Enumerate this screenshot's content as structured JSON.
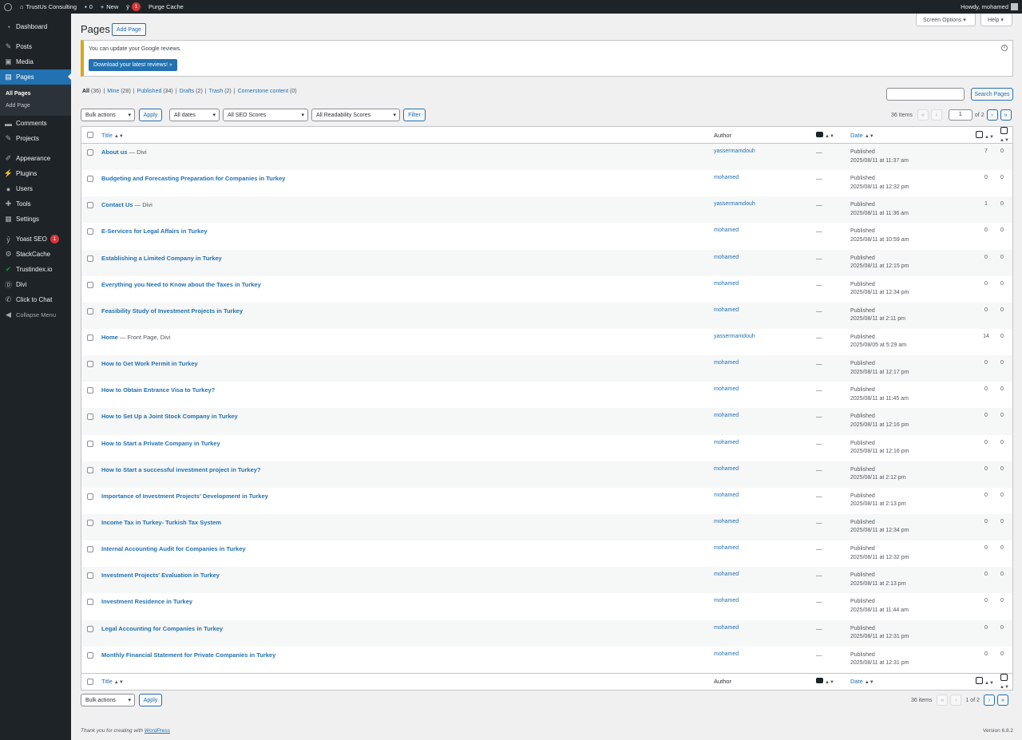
{
  "adminbar": {
    "site_name": "TrustUs Consulting",
    "comments_count": "0",
    "new_label": "New",
    "yoast_badge": "1",
    "purge_label": "Purge Cache",
    "howdy": "Howdy, mohamed"
  },
  "sidebar": {
    "items": [
      {
        "label": "Dashboard",
        "icon": "dashboard-icon"
      },
      {
        "label": "Posts",
        "icon": "pin-icon"
      },
      {
        "label": "Media",
        "icon": "media-icon"
      },
      {
        "label": "Pages",
        "icon": "page-icon"
      },
      {
        "label": "Comments",
        "icon": "comment-icon"
      },
      {
        "label": "Projects",
        "icon": "pin-icon"
      },
      {
        "label": "Appearance",
        "icon": "brush-icon"
      },
      {
        "label": "Plugins",
        "icon": "plug-icon"
      },
      {
        "label": "Users",
        "icon": "user-icon"
      },
      {
        "label": "Tools",
        "icon": "wrench-icon"
      },
      {
        "label": "Settings",
        "icon": "settings-icon"
      },
      {
        "label": "Yoast SEO",
        "icon": "yoast-icon",
        "badge": "1"
      },
      {
        "label": "StackCache",
        "icon": "gear-icon"
      },
      {
        "label": "Trustindex.io",
        "icon": "check-icon"
      },
      {
        "label": "Divi",
        "icon": "divi-icon"
      },
      {
        "label": "Click to Chat",
        "icon": "whatsapp-icon"
      },
      {
        "label": "Collapse Menu",
        "icon": "collapse-icon"
      }
    ],
    "submenu": [
      "All Pages",
      "Add Page"
    ]
  },
  "header": {
    "screen_options": "Screen Options ▾",
    "help": "Help ▾",
    "title": "Pages",
    "add_page": "Add Page"
  },
  "notice": {
    "message": "You can update your Google reviews.",
    "button": "Download your latest reviews! »"
  },
  "filters_links": [
    {
      "label": "All",
      "count": "(36)"
    },
    {
      "label": "Mine",
      "count": "(28)"
    },
    {
      "label": "Published",
      "count": "(34)"
    },
    {
      "label": "Drafts",
      "count": "(2)"
    },
    {
      "label": "Trash",
      "count": "(2)"
    },
    {
      "label": "Cornerstone content",
      "count": "(0)"
    }
  ],
  "search": {
    "button": "Search Pages"
  },
  "toolbar": {
    "bulk_actions": "Bulk actions",
    "apply": "Apply",
    "all_dates": "All dates",
    "seo_scores": "All SEO Scores",
    "readability": "All Readability Scores",
    "filter": "Filter"
  },
  "pagination": {
    "items_top": "36 Items",
    "items_bottom": "36 items",
    "current_page": "1",
    "of_pages": "of 2",
    "bottom_text": "1 of 2",
    "first": "«",
    "prev": "‹",
    "next": "›",
    "last": "»"
  },
  "columns": {
    "title": "Title",
    "author": "Author",
    "date": "Date",
    "sort": "▲▼"
  },
  "rows": [
    {
      "title": "About us",
      "state": " — Divi",
      "author": "yassermamdouh",
      "comments": "—",
      "status": "Published",
      "date": "2025/08/11 at 11:37 am",
      "links_in": "7",
      "links_out": "0"
    },
    {
      "title": "Budgeting and Forecasting Preparation for Companies in Turkey",
      "state": "",
      "author": "mohamed",
      "comments": "—",
      "status": "Published",
      "date": "2025/08/11 at 12:32 pm",
      "links_in": "0",
      "links_out": "0"
    },
    {
      "title": "Contact Us",
      "state": " — Divi",
      "author": "yassermamdouh",
      "comments": "—",
      "status": "Published",
      "date": "2025/08/11 at 11:36 am",
      "links_in": "1",
      "links_out": "0"
    },
    {
      "title": "E-Services for Legal Affairs in Turkey",
      "state": "",
      "author": "mohamed",
      "comments": "—",
      "status": "Published",
      "date": "2025/08/11 at 10:59 am",
      "links_in": "0",
      "links_out": "0"
    },
    {
      "title": "Establishing a Limited Company in Turkey",
      "state": "",
      "author": "mohamed",
      "comments": "—",
      "status": "Published",
      "date": "2025/08/11 at 12:15 pm",
      "links_in": "0",
      "links_out": "0"
    },
    {
      "title": "Everything you Need to Know about the Taxes in Turkey",
      "state": "",
      "author": "mohamed",
      "comments": "—",
      "status": "Published",
      "date": "2025/08/11 at 12:34 pm",
      "links_in": "0",
      "links_out": "0"
    },
    {
      "title": "Feasibility Study of Investment Projects in Turkey",
      "state": "",
      "author": "mohamed",
      "comments": "—",
      "status": "Published",
      "date": "2025/08/11 at 2:11 pm",
      "links_in": "0",
      "links_out": "0"
    },
    {
      "title": "Home",
      "state": " — Front Page, Divi",
      "author": "yassermamdouh",
      "comments": "—",
      "status": "Published",
      "date": "2025/08/05 at 5:29 am",
      "links_in": "14",
      "links_out": "0"
    },
    {
      "title": "How to Get Work Permit in Turkey",
      "state": "",
      "author": "mohamed",
      "comments": "—",
      "status": "Published",
      "date": "2025/08/11 at 12:17 pm",
      "links_in": "0",
      "links_out": "0"
    },
    {
      "title": "How to Obtain Entrance Visa to Turkey?",
      "state": "",
      "author": "mohamed",
      "comments": "—",
      "status": "Published",
      "date": "2025/08/11 at 11:45 am",
      "links_in": "0",
      "links_out": "0"
    },
    {
      "title": "How to Set Up a Joint Stock Company in Turkey",
      "state": "",
      "author": "mohamed",
      "comments": "—",
      "status": "Published",
      "date": "2025/08/11 at 12:16 pm",
      "links_in": "0",
      "links_out": "0"
    },
    {
      "title": "How to Start a Private Company in Turkey",
      "state": "",
      "author": "mohamed",
      "comments": "—",
      "status": "Published",
      "date": "2025/08/11 at 12:16 pm",
      "links_in": "0",
      "links_out": "0"
    },
    {
      "title": "How to Start a successful investment project in Turkey?",
      "state": "",
      "author": "mohamed",
      "comments": "—",
      "status": "Published",
      "date": "2025/08/11 at 2:12 pm",
      "links_in": "0",
      "links_out": "0"
    },
    {
      "title": "Importance of Investment Projects' Development in Turkey",
      "state": "",
      "author": "mohamed",
      "comments": "—",
      "status": "Published",
      "date": "2025/08/11 at 2:13 pm",
      "links_in": "0",
      "links_out": "0"
    },
    {
      "title": "Income Tax in Turkey- Turkish Tax System",
      "state": "",
      "author": "mohamed",
      "comments": "—",
      "status": "Published",
      "date": "2025/08/11 at 12:34 pm",
      "links_in": "0",
      "links_out": "0"
    },
    {
      "title": "Internal Accounting Audit for Companies in Turkey",
      "state": "",
      "author": "mohamed",
      "comments": "—",
      "status": "Published",
      "date": "2025/08/11 at 12:32 pm",
      "links_in": "0",
      "links_out": "0"
    },
    {
      "title": "Investment Projects' Evaluation in Turkey",
      "state": "",
      "author": "mohamed",
      "comments": "—",
      "status": "Published",
      "date": "2025/08/11 at 2:13 pm",
      "links_in": "0",
      "links_out": "0"
    },
    {
      "title": "Investment Residence in Turkey",
      "state": "",
      "author": "mohamed",
      "comments": "—",
      "status": "Published",
      "date": "2025/08/11 at 11:44 am",
      "links_in": "0",
      "links_out": "0"
    },
    {
      "title": "Legal Accounting for Companies in Turkey",
      "state": "",
      "author": "mohamed",
      "comments": "—",
      "status": "Published",
      "date": "2025/08/11 at 12:31 pm",
      "links_in": "0",
      "links_out": "0"
    },
    {
      "title": "Monthly Financial Statement for Private Companies in Turkey",
      "state": "",
      "author": "mohamed",
      "comments": "—",
      "status": "Published",
      "date": "2025/08/11 at 12:31 pm",
      "links_in": "0",
      "links_out": "0"
    }
  ],
  "footer": {
    "thanks": "Thank you for creating with ",
    "wp_link": "WordPress",
    "version": "Version 6.8.2"
  },
  "colors": {
    "accent": "#2271b1",
    "sidebar_bg": "#1d2327",
    "notice_border": "#dba617",
    "badge": "#d63638"
  }
}
